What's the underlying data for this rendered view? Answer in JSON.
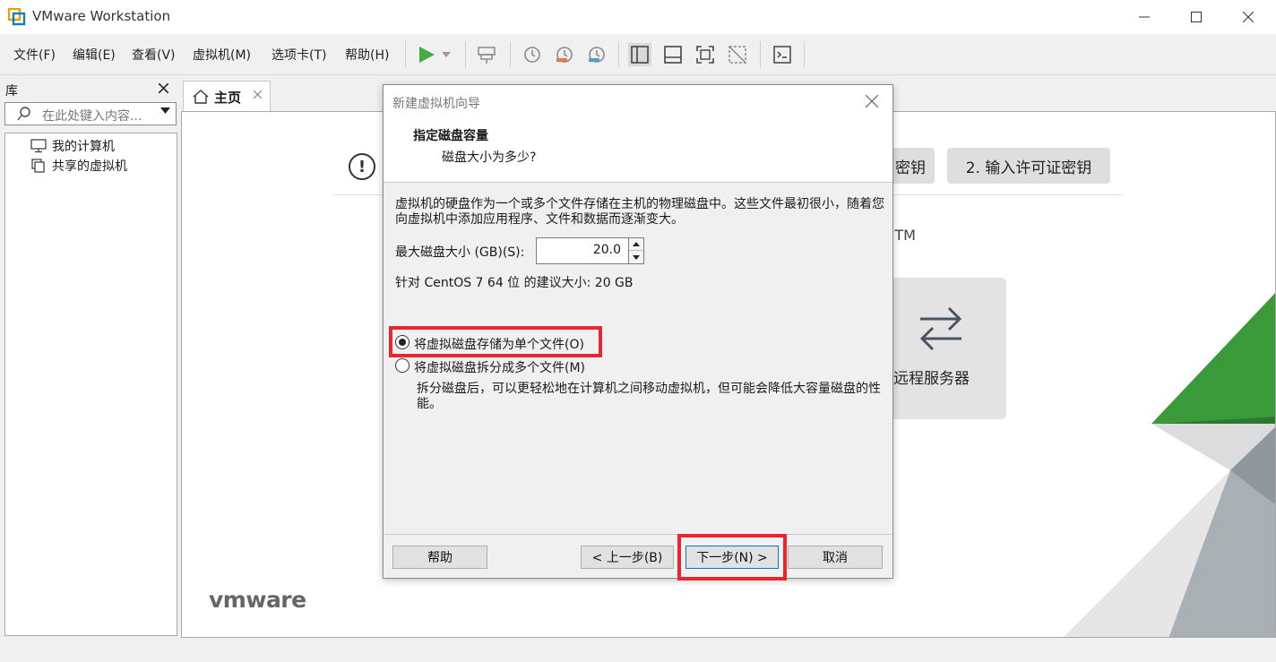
{
  "window": {
    "title": "VMware Workstation"
  },
  "menu": [
    "文件(F)",
    "编辑(E)",
    "查看(V)",
    "虚拟机(M)",
    "选项卡(T)",
    "帮助(H)"
  ],
  "library": {
    "title": "库",
    "search_placeholder": "在此处键入内容...",
    "items": [
      {
        "label": "我的计算机",
        "icon": "computer-icon"
      },
      {
        "label": "共享的虚拟机",
        "icon": "shared-vm-icon"
      }
    ]
  },
  "tabs": [
    {
      "label": "主页",
      "icon": "home-icon"
    }
  ],
  "home": {
    "license_btn_1_partial": "密钥",
    "license_btn_2": "2. 输入许可证密钥",
    "tm": "TM",
    "remote_card_label": "远程服务器",
    "logo_text": "vmware"
  },
  "dialog": {
    "title": "新建虚拟机向导",
    "heading": "指定磁盘容量",
    "subheading": "磁盘大小为多少?",
    "description": "虚拟机的硬盘作为一个或多个文件存储在主机的物理磁盘中。这些文件最初很小，随着您向虚拟机中添加应用程序、文件和数据而逐渐变大。",
    "max_size_label": "最大磁盘大小 (GB)(S):",
    "max_size_value": "20.0",
    "recommendation": "针对 CentOS 7 64 位 的建议大小: 20 GB",
    "options": [
      {
        "label": "将虚拟磁盘存储为单个文件(O)",
        "selected": true
      },
      {
        "label": "将虚拟磁盘拆分成多个文件(M)",
        "selected": false
      }
    ],
    "split_description": "拆分磁盘后，可以更轻松地在计算机之间移动虚拟机，但可能会降低大容量磁盘的性能。",
    "buttons": {
      "help": "帮助",
      "back": "< 上一步(B)",
      "next": "下一步(N) >",
      "cancel": "取消"
    }
  },
  "colors": {
    "highlight_red": "#e8262f",
    "play_green": "#3fae3c",
    "vmware_green": "#3a9a3a"
  }
}
